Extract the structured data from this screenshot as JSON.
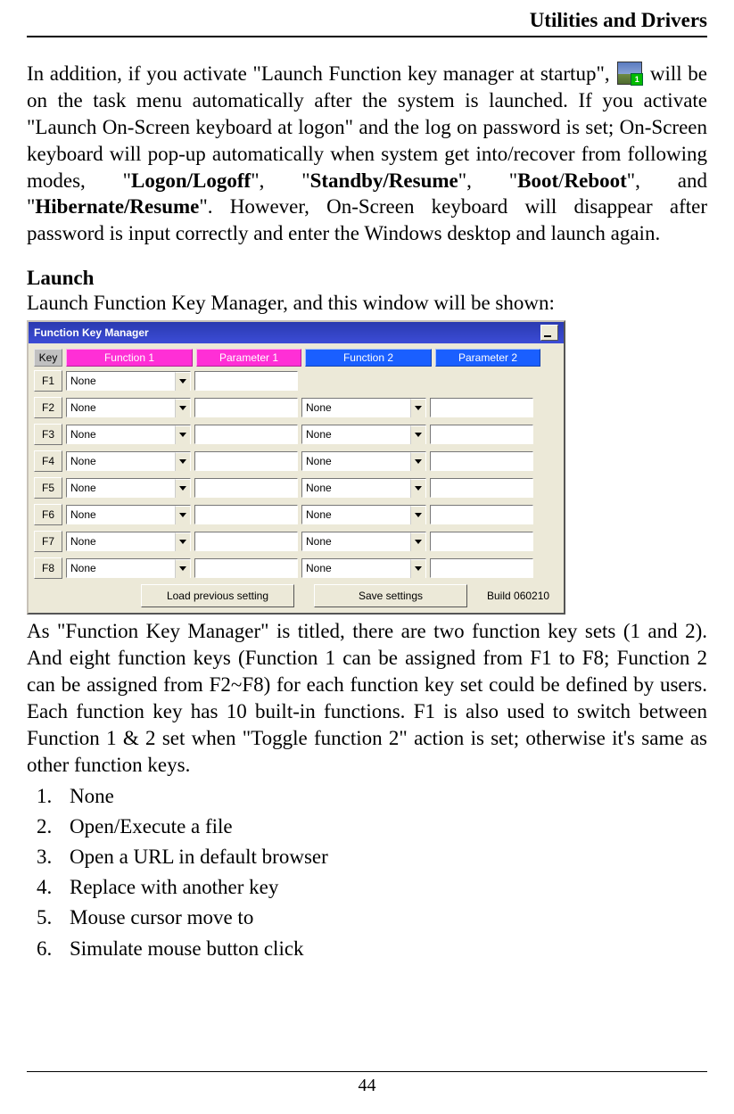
{
  "header": {
    "title": "Utilities and Drivers"
  },
  "para1": {
    "t1": "In addition, if you activate \"Launch Function key manager at startup\", ",
    "icon_badge": "1",
    "t2": " will be on the task menu automatically after the system is launched. If you activate \"Launch On-Screen keyboard at logon\" and the log on password is set; On-Screen keyboard will pop-up automatically when system get into/recover from following modes, \"",
    "b1": "Logon/Logoff",
    "t3": "\", \"",
    "b2": "Standby/Resume",
    "t4": "\", \"",
    "b3": "Boot",
    "t5": "/",
    "b4": "Reboot",
    "t6": "\", and \"",
    "b5": "Hibernate/Resume",
    "t7": "\". However, On-Screen keyboard will disappear after password is input correctly and enter the Windows desktop and launch again."
  },
  "section": {
    "title": "Launch",
    "intro": "Launch Function Key Manager, and this window will be shown:"
  },
  "window": {
    "title": "Function Key Manager",
    "headers": {
      "key": "Key",
      "f1": "Function 1",
      "p1": "Parameter 1",
      "f2": "Function 2",
      "p2": "Parameter 2"
    },
    "rows": [
      {
        "key": "F1",
        "f1": "None",
        "has2": false
      },
      {
        "key": "F2",
        "f1": "None",
        "has2": true,
        "f2": "None"
      },
      {
        "key": "F3",
        "f1": "None",
        "has2": true,
        "f2": "None"
      },
      {
        "key": "F4",
        "f1": "None",
        "has2": true,
        "f2": "None"
      },
      {
        "key": "F5",
        "f1": "None",
        "has2": true,
        "f2": "None"
      },
      {
        "key": "F6",
        "f1": "None",
        "has2": true,
        "f2": "None"
      },
      {
        "key": "F7",
        "f1": "None",
        "has2": true,
        "f2": "None"
      },
      {
        "key": "F8",
        "f1": "None",
        "has2": true,
        "f2": "None"
      }
    ],
    "buttons": {
      "load": "Load previous setting",
      "save": "Save settings"
    },
    "build": "Build 060210"
  },
  "para2": "As \"Function Key Manager\" is titled, there are two function key sets (1 and 2). And eight function keys (Function 1 can be assigned from F1 to F8; Function 2 can be assigned from F2~F8) for each function key set could be defined by users. Each function key has 10 built-in functions. F1 is also used to switch between Function 1 & 2 set when \"Toggle function 2\" action is set; otherwise it's same as other function keys.",
  "list": [
    "None",
    "Open/Execute a file",
    "Open a URL in default browser",
    "Replace with another key",
    "Mouse cursor move to",
    "Simulate mouse button click"
  ],
  "footer": {
    "page": "44"
  }
}
